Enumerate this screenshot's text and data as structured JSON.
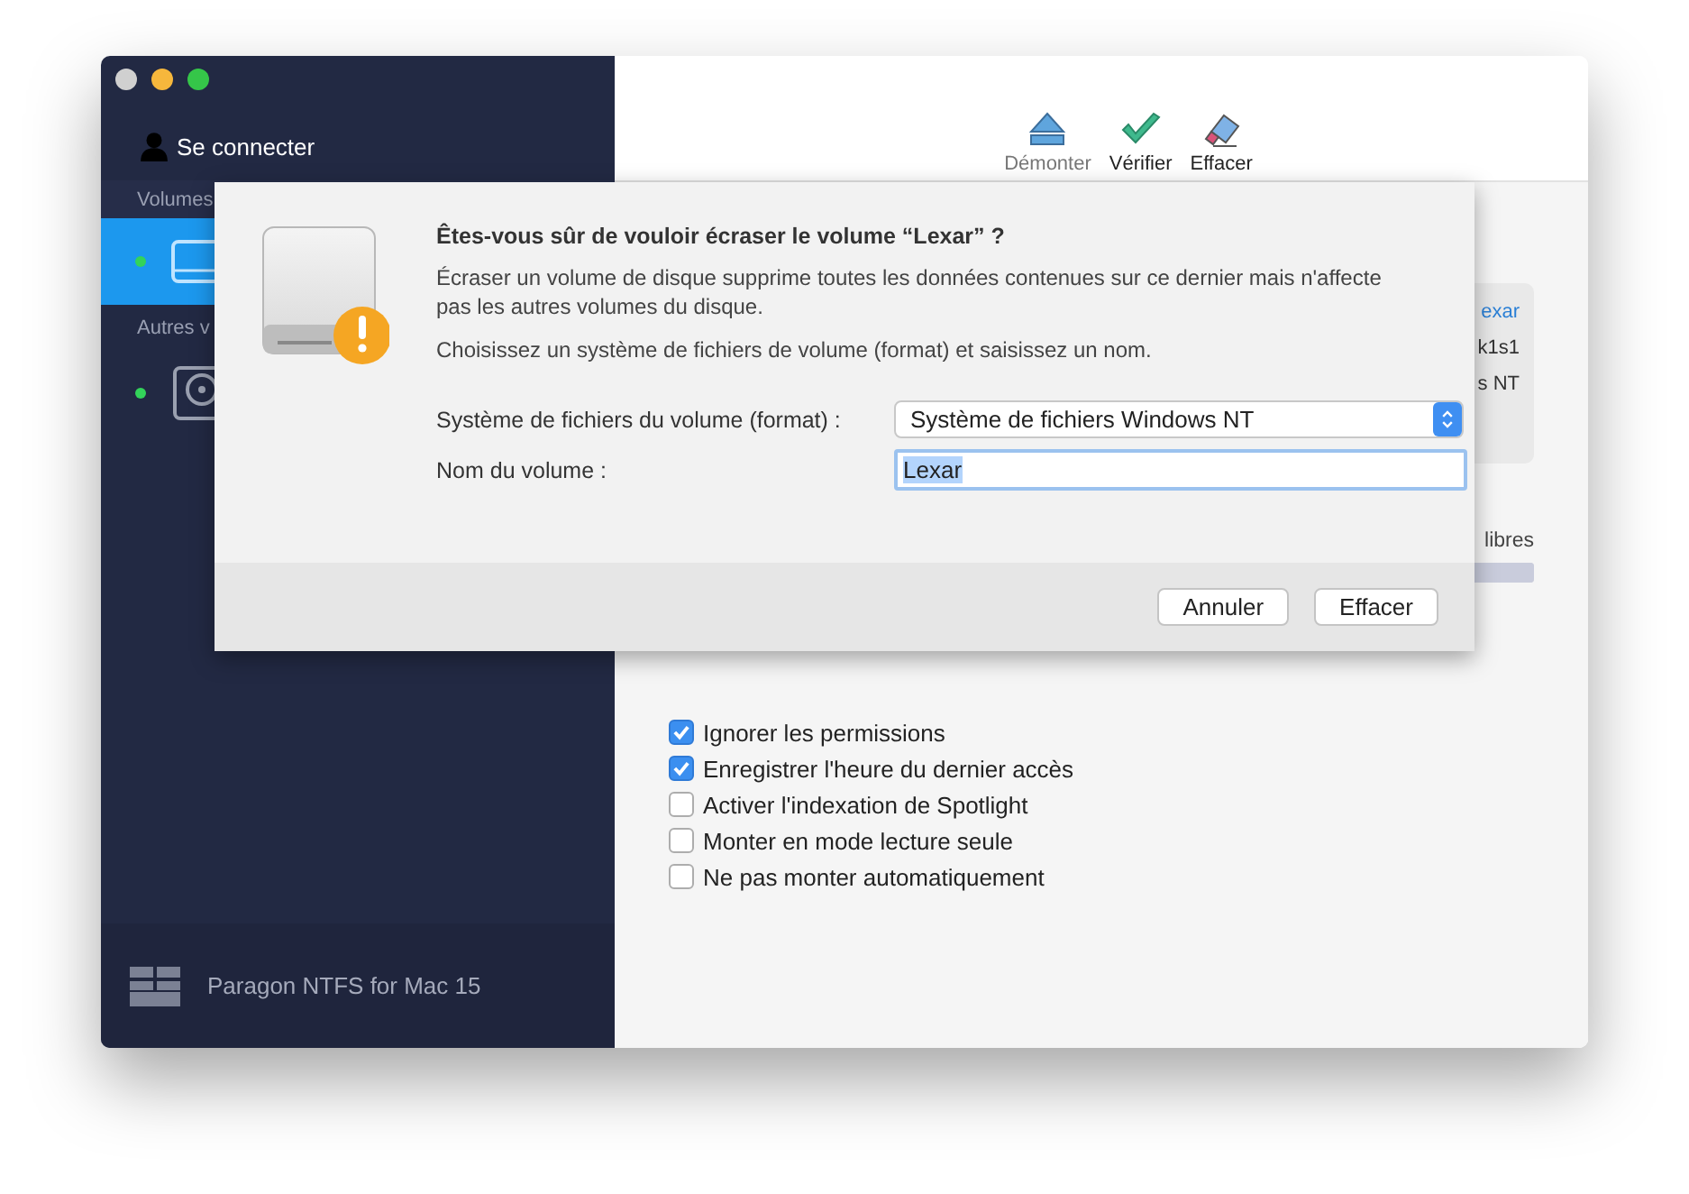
{
  "sidebar": {
    "account": "Se connecter",
    "sections": [
      {
        "title": "Volumes",
        "items": [
          {
            "kind": "usb",
            "selected": true
          }
        ]
      },
      {
        "title": "Autres v",
        "items": [
          {
            "kind": "hdd",
            "selected": false
          }
        ]
      }
    ],
    "footer": "Paragon NTFS for Mac 15"
  },
  "toolbar": [
    {
      "label": "Démonter",
      "kind": "eject",
      "disabled": true
    },
    {
      "label": "Vérifier",
      "kind": "check",
      "disabled": false
    },
    {
      "label": "Effacer",
      "kind": "erase",
      "disabled": false
    }
  ],
  "info_card": {
    "lines": [
      {
        "text": "exar",
        "kind": "link"
      },
      {
        "text": "k1s1",
        "kind": "plain"
      },
      {
        "text": "s NT",
        "kind": "plain"
      }
    ]
  },
  "space": {
    "label": "libres",
    "level": 1
  },
  "options": [
    {
      "label": "Ignorer les permissions",
      "checked": true
    },
    {
      "label": "Enregistrer l'heure du dernier accès",
      "checked": true
    },
    {
      "label": "Activer l'indexation de Spotlight",
      "checked": false
    },
    {
      "label": "Monter en mode lecture seule",
      "checked": false
    },
    {
      "label": "Ne pas monter automatiquement",
      "checked": false
    }
  ],
  "dialog": {
    "title": "Êtes-vous sûr de vouloir écraser le volume “Lexar” ?",
    "paragraphs": [
      "Écraser un volume de disque supprime toutes les données contenues sur ce dernier mais n'affecte pas les autres volumes du disque.",
      "Choisissez un système de fichiers de volume (format) et saisissez un nom."
    ],
    "format_label": "Système de fichiers du volume (format) :",
    "format_value": "Système de fichiers Windows NT",
    "name_label": "Nom du volume :",
    "name_value": "Lexar",
    "buttons": [
      {
        "label": "Annuler"
      },
      {
        "label": "Effacer"
      }
    ]
  }
}
